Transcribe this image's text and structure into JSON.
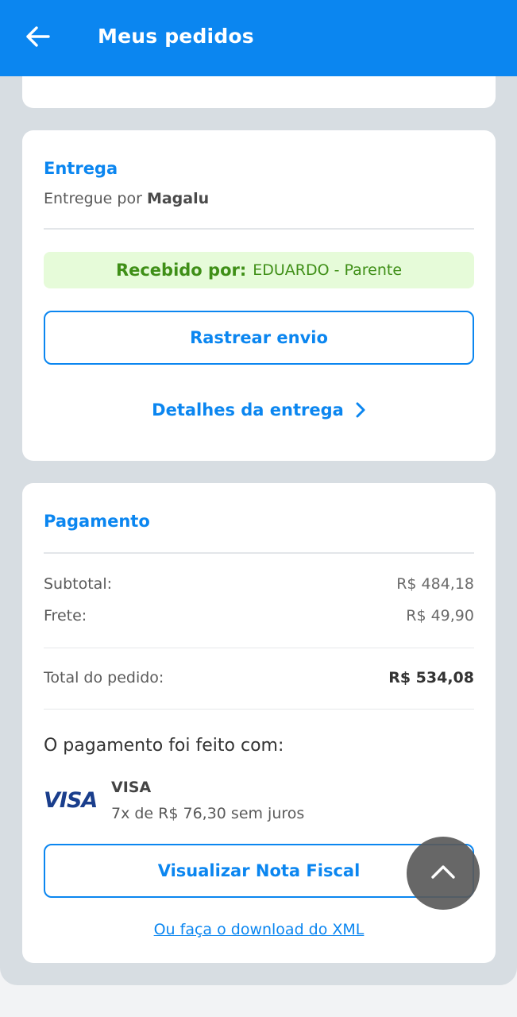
{
  "header": {
    "title": "Meus pedidos",
    "back_icon": "arrow-left-icon",
    "color": "#0b86f0"
  },
  "delivery": {
    "title": "Entrega",
    "delivered_by_prefix": "Entregue por ",
    "delivered_by_name": "Magalu",
    "received_label": "Recebido por:",
    "received_value": "EDUARDO - Parente",
    "track_button": "Rastrear envio",
    "details_link": "Detalhes da entrega",
    "details_icon": "chevron-right-icon"
  },
  "payment": {
    "title": "Pagamento",
    "subtotal_label": "Subtotal:",
    "subtotal_value": "R$ 484,18",
    "shipping_label": "Frete:",
    "shipping_value": "R$ 49,90",
    "total_label": "Total do pedido:",
    "total_value": "R$ 534,08",
    "paid_with": "O pagamento foi feito com:",
    "card_logo": "VISA",
    "card_brand": "VISA",
    "installments": "7x de R$ 76,30 sem juros",
    "invoice_button": "Visualizar Nota Fiscal",
    "xml_link": "Ou faça o download do XML"
  },
  "fab": {
    "icon": "chevron-up-icon"
  }
}
